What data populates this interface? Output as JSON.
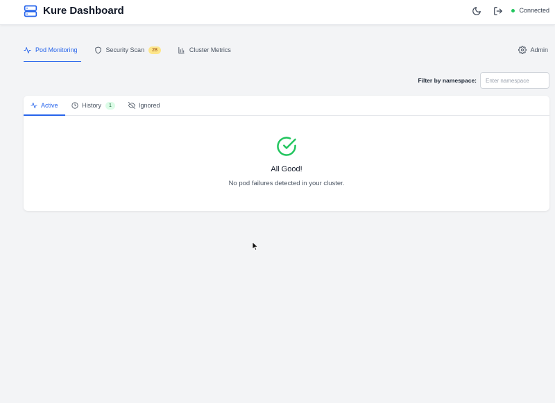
{
  "app": {
    "title": "Kure Dashboard"
  },
  "header": {
    "status_label": "Connected",
    "status_color": "#22c55e",
    "icons": [
      "server-icon",
      "moon-icon",
      "logout-icon"
    ]
  },
  "nav": {
    "tabs": [
      {
        "label": "Pod Monitoring",
        "icon": "activity-icon",
        "active": true
      },
      {
        "label": "Security Scan",
        "icon": "shield-icon",
        "badge": "28"
      },
      {
        "label": "Cluster Metrics",
        "icon": "bar-chart-icon"
      }
    ],
    "admin_label": "Admin",
    "accent": "#2563eb"
  },
  "filter": {
    "label": "Filter by namespace:",
    "placeholder": "Enter namespace",
    "value": ""
  },
  "subtabs": [
    {
      "label": "Active",
      "icon": "activity-icon",
      "active": true
    },
    {
      "label": "History",
      "icon": "clock-icon",
      "badge": "1"
    },
    {
      "label": "Ignored",
      "icon": "eye-off-icon"
    }
  ],
  "empty_state": {
    "icon": "check-circle-icon",
    "title": "All Good!",
    "description": "No pod failures detected in your cluster."
  }
}
